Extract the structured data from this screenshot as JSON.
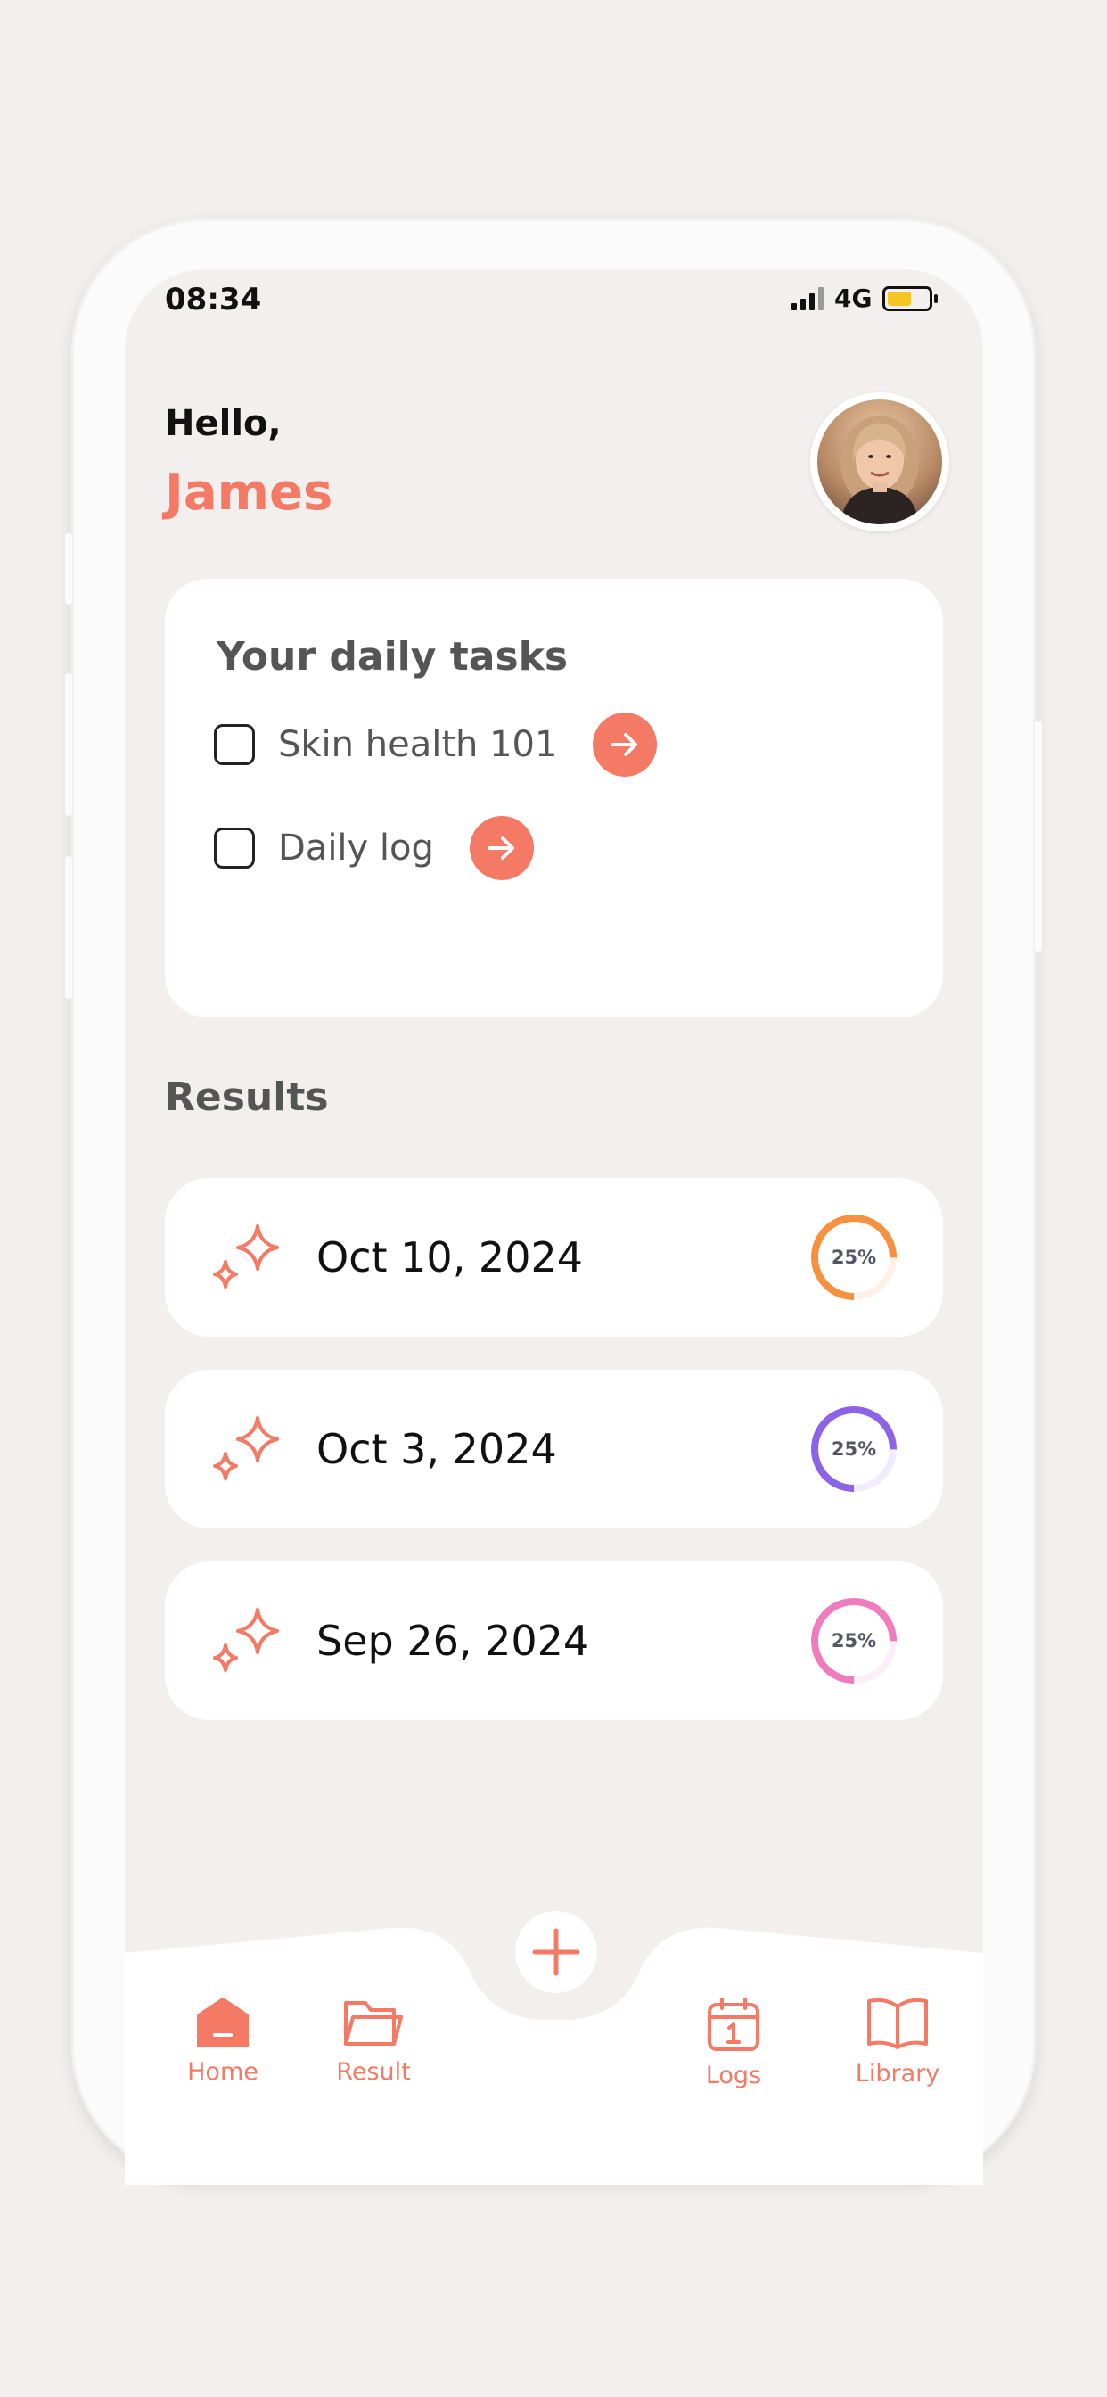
{
  "status": {
    "time": "08:34",
    "network": "4G"
  },
  "greeting": {
    "hello": "Hello,",
    "name": "James"
  },
  "tasks": {
    "title": "Your daily tasks",
    "items": [
      {
        "label": "Skin health 101",
        "checked": false
      },
      {
        "label": "Daily log",
        "checked": false
      }
    ]
  },
  "results": {
    "title": "Results",
    "items": [
      {
        "date": "Oct 10, 2024",
        "progress_label": "25%",
        "progress": 0.25,
        "color": "#f7913f"
      },
      {
        "date": "Oct 3, 2024",
        "progress_label": "25%",
        "progress": 0.25,
        "color": "#8c63e6"
      },
      {
        "date": "Sep 26, 2024",
        "progress_label": "25%",
        "progress": 0.25,
        "color": "#f07bbd"
      }
    ]
  },
  "nav": {
    "items": [
      {
        "label": "Home",
        "icon": "home-icon",
        "active": true
      },
      {
        "label": "Result",
        "icon": "folder-icon",
        "active": false
      },
      {
        "label": "Logs",
        "icon": "calendar-icon",
        "active": false
      },
      {
        "label": "Library",
        "icon": "book-icon",
        "active": false
      }
    ],
    "add_icon": "plus-icon"
  },
  "colors": {
    "accent": "#f47a66",
    "background": "#f3efee",
    "card": "#ffffff"
  }
}
